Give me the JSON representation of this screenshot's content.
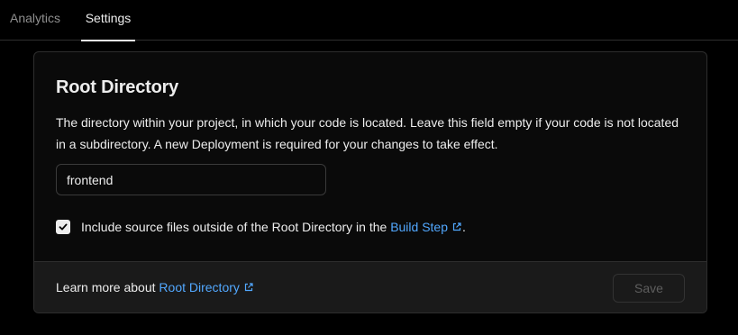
{
  "tabs": [
    {
      "label": "Analytics",
      "active": false
    },
    {
      "label": "Settings",
      "active": true
    }
  ],
  "section": {
    "title": "Root Directory",
    "description": "The directory within your project, in which your code is located. Leave this field empty if your code is not located in a subdirectory. A new Deployment is required for your changes to take effect.",
    "input_value": "frontend",
    "checkbox": {
      "checked": true,
      "label_prefix": "Include source files outside of the Root Directory in the",
      "link_text": "Build Step",
      "label_suffix": "."
    },
    "footer": {
      "learn_prefix": "Learn more about",
      "learn_link": "Root Directory",
      "save_label": "Save"
    }
  },
  "colors": {
    "background": "#000000",
    "card": "#0a0a0a",
    "footer": "#1a1a1a",
    "border": "#2e2e2e",
    "link": "#52a8ff",
    "text": "#ededed",
    "muted": "#8f8f8f"
  },
  "icons": {
    "external_link": "external-link-icon",
    "checkmark": "check-icon"
  }
}
